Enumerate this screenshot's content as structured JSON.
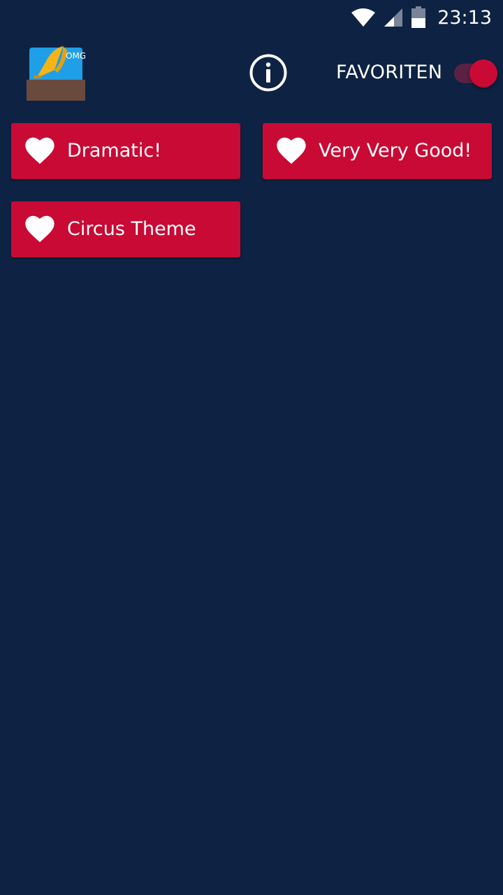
{
  "status_bar": {
    "time": "23:13",
    "icons": [
      "wifi-icon",
      "signal-icon",
      "battery-icon"
    ]
  },
  "header": {
    "logo_icon": "gramophone-logo-icon",
    "info_icon": "info-icon",
    "favorites_label": "FAVORITEN",
    "favorites_toggle_on": true
  },
  "sounds": [
    {
      "label": "Dramatic!",
      "icon": "heart-icon"
    },
    {
      "label": "Very Very Good!",
      "icon": "heart-icon"
    },
    {
      "label": "Circus Theme",
      "icon": "heart-icon"
    }
  ],
  "colors": {
    "background": "#0e2243",
    "button": "#c80a35",
    "switch_thumb": "#c80a35",
    "switch_track": "#5a2145",
    "text": "#ffffff"
  }
}
